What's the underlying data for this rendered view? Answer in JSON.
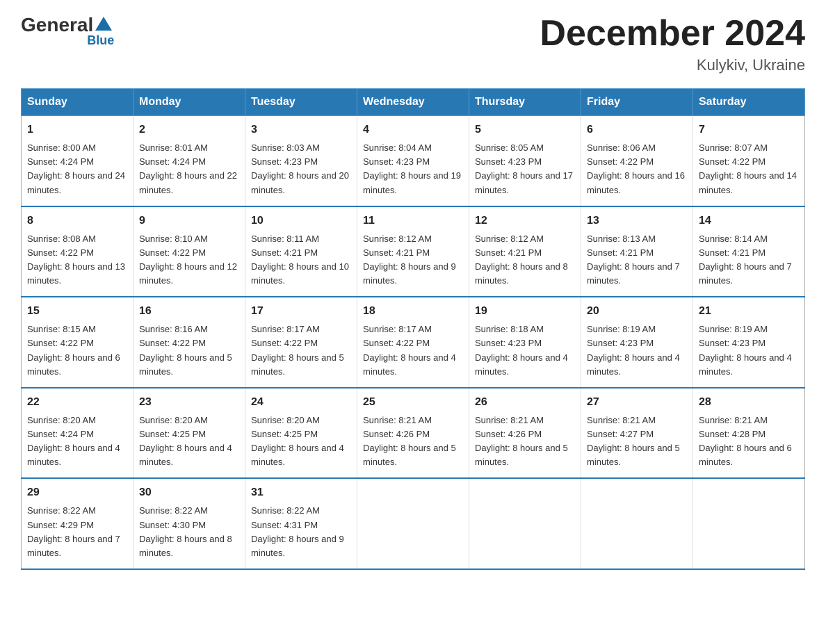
{
  "header": {
    "logo_general": "General",
    "logo_blue": "Blue",
    "month_title": "December 2024",
    "location": "Kulykiv, Ukraine"
  },
  "weekdays": [
    "Sunday",
    "Monday",
    "Tuesday",
    "Wednesday",
    "Thursday",
    "Friday",
    "Saturday"
  ],
  "weeks": [
    [
      {
        "day": "1",
        "sunrise": "8:00 AM",
        "sunset": "4:24 PM",
        "daylight": "8 hours and 24 minutes."
      },
      {
        "day": "2",
        "sunrise": "8:01 AM",
        "sunset": "4:24 PM",
        "daylight": "8 hours and 22 minutes."
      },
      {
        "day": "3",
        "sunrise": "8:03 AM",
        "sunset": "4:23 PM",
        "daylight": "8 hours and 20 minutes."
      },
      {
        "day": "4",
        "sunrise": "8:04 AM",
        "sunset": "4:23 PM",
        "daylight": "8 hours and 19 minutes."
      },
      {
        "day": "5",
        "sunrise": "8:05 AM",
        "sunset": "4:23 PM",
        "daylight": "8 hours and 17 minutes."
      },
      {
        "day": "6",
        "sunrise": "8:06 AM",
        "sunset": "4:22 PM",
        "daylight": "8 hours and 16 minutes."
      },
      {
        "day": "7",
        "sunrise": "8:07 AM",
        "sunset": "4:22 PM",
        "daylight": "8 hours and 14 minutes."
      }
    ],
    [
      {
        "day": "8",
        "sunrise": "8:08 AM",
        "sunset": "4:22 PM",
        "daylight": "8 hours and 13 minutes."
      },
      {
        "day": "9",
        "sunrise": "8:10 AM",
        "sunset": "4:22 PM",
        "daylight": "8 hours and 12 minutes."
      },
      {
        "day": "10",
        "sunrise": "8:11 AM",
        "sunset": "4:21 PM",
        "daylight": "8 hours and 10 minutes."
      },
      {
        "day": "11",
        "sunrise": "8:12 AM",
        "sunset": "4:21 PM",
        "daylight": "8 hours and 9 minutes."
      },
      {
        "day": "12",
        "sunrise": "8:12 AM",
        "sunset": "4:21 PM",
        "daylight": "8 hours and 8 minutes."
      },
      {
        "day": "13",
        "sunrise": "8:13 AM",
        "sunset": "4:21 PM",
        "daylight": "8 hours and 7 minutes."
      },
      {
        "day": "14",
        "sunrise": "8:14 AM",
        "sunset": "4:21 PM",
        "daylight": "8 hours and 7 minutes."
      }
    ],
    [
      {
        "day": "15",
        "sunrise": "8:15 AM",
        "sunset": "4:22 PM",
        "daylight": "8 hours and 6 minutes."
      },
      {
        "day": "16",
        "sunrise": "8:16 AM",
        "sunset": "4:22 PM",
        "daylight": "8 hours and 5 minutes."
      },
      {
        "day": "17",
        "sunrise": "8:17 AM",
        "sunset": "4:22 PM",
        "daylight": "8 hours and 5 minutes."
      },
      {
        "day": "18",
        "sunrise": "8:17 AM",
        "sunset": "4:22 PM",
        "daylight": "8 hours and 4 minutes."
      },
      {
        "day": "19",
        "sunrise": "8:18 AM",
        "sunset": "4:23 PM",
        "daylight": "8 hours and 4 minutes."
      },
      {
        "day": "20",
        "sunrise": "8:19 AM",
        "sunset": "4:23 PM",
        "daylight": "8 hours and 4 minutes."
      },
      {
        "day": "21",
        "sunrise": "8:19 AM",
        "sunset": "4:23 PM",
        "daylight": "8 hours and 4 minutes."
      }
    ],
    [
      {
        "day": "22",
        "sunrise": "8:20 AM",
        "sunset": "4:24 PM",
        "daylight": "8 hours and 4 minutes."
      },
      {
        "day": "23",
        "sunrise": "8:20 AM",
        "sunset": "4:25 PM",
        "daylight": "8 hours and 4 minutes."
      },
      {
        "day": "24",
        "sunrise": "8:20 AM",
        "sunset": "4:25 PM",
        "daylight": "8 hours and 4 minutes."
      },
      {
        "day": "25",
        "sunrise": "8:21 AM",
        "sunset": "4:26 PM",
        "daylight": "8 hours and 5 minutes."
      },
      {
        "day": "26",
        "sunrise": "8:21 AM",
        "sunset": "4:26 PM",
        "daylight": "8 hours and 5 minutes."
      },
      {
        "day": "27",
        "sunrise": "8:21 AM",
        "sunset": "4:27 PM",
        "daylight": "8 hours and 5 minutes."
      },
      {
        "day": "28",
        "sunrise": "8:21 AM",
        "sunset": "4:28 PM",
        "daylight": "8 hours and 6 minutes."
      }
    ],
    [
      {
        "day": "29",
        "sunrise": "8:22 AM",
        "sunset": "4:29 PM",
        "daylight": "8 hours and 7 minutes."
      },
      {
        "day": "30",
        "sunrise": "8:22 AM",
        "sunset": "4:30 PM",
        "daylight": "8 hours and 8 minutes."
      },
      {
        "day": "31",
        "sunrise": "8:22 AM",
        "sunset": "4:31 PM",
        "daylight": "8 hours and 9 minutes."
      },
      null,
      null,
      null,
      null
    ]
  ]
}
